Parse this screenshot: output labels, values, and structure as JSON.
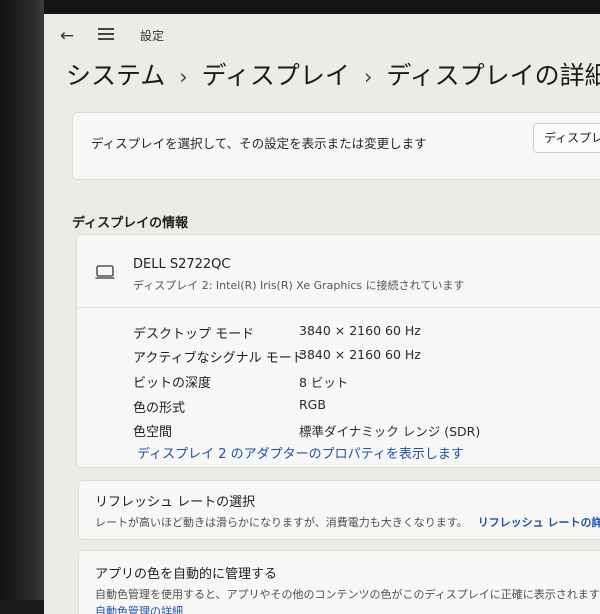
{
  "window": {
    "app_title": "設定"
  },
  "breadcrumb": {
    "level1": "システム",
    "level2": "ディスプレイ",
    "level3": "ディスプレイの詳細設定"
  },
  "select_card": {
    "text": "ディスプレイを選択して、その設定を表示または変更します",
    "select_value": "ディスプレ"
  },
  "info_section": {
    "title": "ディスプレイの情報",
    "display_name": "DELL S2722QC",
    "display_sub": "ディスプレイ 2: Intel(R) Iris(R) Xe Graphics に接続されています",
    "properties": [
      {
        "label": "デスクトップ モード",
        "value": "3840 × 2160 60 Hz"
      },
      {
        "label": "アクティブなシグナル モード",
        "value": "3840 × 2160 60 Hz"
      },
      {
        "label": "ビットの深度",
        "value": "8 ビット"
      },
      {
        "label": "色の形式",
        "value": "RGB"
      },
      {
        "label": "色空間",
        "value": "標準ダイナミック レンジ (SDR)"
      }
    ],
    "adapter_link": "ディスプレイ 2 のアダプターのプロパティを表示します"
  },
  "refresh_card": {
    "title": "リフレッシュ レートの選択",
    "description": "レートが高いほど動きは滑らかになりますが、消費電力も大きくなります。",
    "link": "リフレッシュ レートの詳細"
  },
  "color_card": {
    "title": "アプリの色を自動的に管理する",
    "description": "自動色管理を使用すると、アプリやその他のコンテンツの色がこのディスプレイに正確に表示されます (これにより",
    "link": "自動色管理の詳細"
  }
}
